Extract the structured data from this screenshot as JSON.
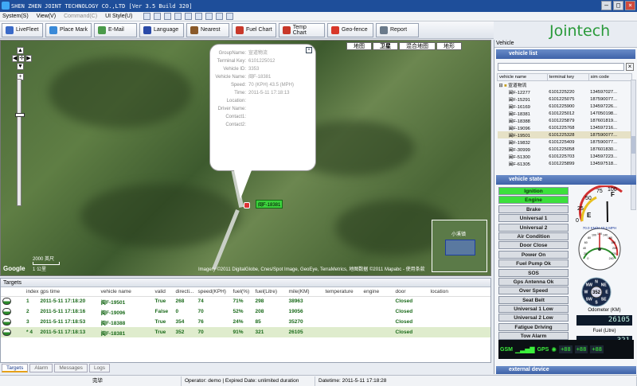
{
  "window": {
    "title": "SHEN ZHEN JOINT TECHNOLOGY CO.,LTD [Ver 3.5  Build 320]"
  },
  "menu": {
    "items": [
      {
        "label": "System(S)",
        "enabled": true
      },
      {
        "label": "View(V)",
        "enabled": true
      },
      {
        "label": "Command(C)",
        "enabled": false
      },
      {
        "label": "UI Style(U)",
        "enabled": true
      }
    ]
  },
  "toolbar": {
    "buttons": [
      {
        "label": "LiveFleet",
        "icon": "fleet-icon",
        "color": "#3a6ac8"
      },
      {
        "label": "Place Mark",
        "icon": "pin-icon",
        "color": "#3a8ad8"
      },
      {
        "label": "E-Mail",
        "icon": "mail-icon",
        "color": "#4a9a4a"
      },
      {
        "label": "Language",
        "icon": "language-icon",
        "color": "#2a4aa8"
      },
      {
        "label": "Nearest",
        "icon": "nearest-icon",
        "color": "#8a5a2a"
      },
      {
        "label": "Fuel Chart",
        "icon": "fuel-icon",
        "color": "#c8382a"
      },
      {
        "label": "Temp Chart",
        "icon": "temp-icon",
        "color": "#c8382a"
      },
      {
        "label": "Geo-fence",
        "icon": "geofence-icon",
        "color": "#d8382a"
      },
      {
        "label": "Report",
        "icon": "report-icon",
        "color": "#6a7a8a"
      }
    ]
  },
  "logo": {
    "text_main": "Jointech",
    "color": "#1a4aa0"
  },
  "map": {
    "tabs": [
      "地图",
      "卫星",
      "混合地图",
      "地形"
    ],
    "active_tab": "卫星",
    "scale_label": "2000 英尺",
    "scale_label_2": "1 公里",
    "copyright": "Imagery ©2011 DigitalGlobe, Cnes/Spot Image, GeoEye, TerraMetrics, 地图数据 ©2011 Mapabc - 使用条款",
    "minimap_label": "小溪镇",
    "vehicle_label": "闽F-18381",
    "google": "Google"
  },
  "popup": {
    "rows": [
      {
        "key": "GroupName:",
        "value": "宣道物流"
      },
      {
        "key": "Terminal Key:",
        "value": "6101225012"
      },
      {
        "key": "Vehicle ID:",
        "value": "3353"
      },
      {
        "key": "Vehicle Name:",
        "value": "闽F-18381"
      },
      {
        "key": "Speed:",
        "value": "70 (KPH) 43.5 (MPH)"
      },
      {
        "key": "Time:",
        "value": "2011-5-11 17:18:13"
      },
      {
        "key": "Location:",
        "value": ""
      },
      {
        "key": "Driver Name:",
        "value": ""
      },
      {
        "key": "Contact1:",
        "value": ""
      },
      {
        "key": "Contact2:",
        "value": ""
      }
    ]
  },
  "targets": {
    "title": "Targets",
    "columns": [
      "index",
      "gps time",
      "vehicle name",
      "valid",
      "directi...",
      "speed(KPH)",
      "fuel(%)",
      "fuel(Litre)",
      "mile(KM)",
      "temperature",
      "engine",
      "door",
      "location"
    ],
    "rows": [
      {
        "index": "1",
        "time": "2011-5-11 17:18:20",
        "name": "闽F-19501",
        "valid": "True",
        "dir": "268",
        "speed": "74",
        "fuelp": "71%",
        "fuell": "298",
        "mile": "38963",
        "temp": "",
        "engine": "",
        "door": "Closed",
        "loc": ""
      },
      {
        "index": "2",
        "time": "2011-5-11 17:18:16",
        "name": "闽F-19096",
        "valid": "False",
        "dir": "0",
        "speed": "70",
        "fuelp": "52%",
        "fuell": "208",
        "mile": "19056",
        "temp": "",
        "engine": "",
        "door": "Closed",
        "loc": ""
      },
      {
        "index": "3",
        "time": "2011-5-11 17:18:53",
        "name": "闽F-18388",
        "valid": "True",
        "dir": "354",
        "speed": "76",
        "fuelp": "24%",
        "fuell": "85",
        "mile": "35270",
        "temp": "",
        "engine": "",
        "door": "Closed",
        "loc": ""
      },
      {
        "index": "* 4",
        "time": "2011-5-11 17:18:13",
        "name": "闽F-18381",
        "valid": "True",
        "dir": "352",
        "speed": "70",
        "fuelp": "91%",
        "fuell": "321",
        "mile": "26105",
        "temp": "",
        "engine": "",
        "door": "Closed",
        "loc": ""
      }
    ]
  },
  "bottom_tabs": [
    "Targets",
    "Alarm",
    "Messages",
    "Logs"
  ],
  "status": {
    "ready": "完毕",
    "operator": "Operator: demo | Expired Date: unlimited duration",
    "datetime": "Datetime: 2011-5-11 17:18:28"
  },
  "vehicle_panel": {
    "title": "Vehicle",
    "list_title": "vehicle list",
    "columns": [
      "vehicle name",
      "terminal key",
      "sim code"
    ],
    "group": "宣道物流",
    "rows": [
      [
        "闽F-12277",
        "6101225220",
        "134597027..."
      ],
      [
        "闽F-15291",
        "6101225075",
        "187590077..."
      ],
      [
        "闽F-16169",
        "6101225900",
        "134597226..."
      ],
      [
        "闽F-18381",
        "6101225012",
        "147050198..."
      ],
      [
        "闽F-18388",
        "6101225879",
        "187601819..."
      ],
      [
        "闽F-19096",
        "6101225768",
        "134597216..."
      ],
      [
        "闽F-19501",
        "6101225328",
        "187590077..."
      ],
      [
        "闽F-19832",
        "6101225409",
        "187590077..."
      ],
      [
        "闽F-30999",
        "6101225058",
        "187601830..."
      ],
      [
        "闽F-51300",
        "6101225703",
        "134597223..."
      ],
      [
        "闽F-61305",
        "6101225899",
        "134597518..."
      ]
    ],
    "selected_index": 6
  },
  "vehicle_state": {
    "title": "vehicle state",
    "items": [
      {
        "label": "Ignition",
        "state": "on"
      },
      {
        "label": "Engine",
        "state": "on"
      },
      {
        "label": "Brake",
        "state": "off"
      },
      {
        "label": "Universal 1",
        "state": "off"
      },
      {
        "label": "Universal 2",
        "state": "off"
      },
      {
        "label": "Air Condition",
        "state": "off"
      },
      {
        "label": "Door Close",
        "state": "off"
      },
      {
        "label": "Power On",
        "state": "off"
      },
      {
        "label": "Fuel Pump Ok",
        "state": "off"
      },
      {
        "label": "SOS",
        "state": "off"
      },
      {
        "label": "Gps Antenna Ok",
        "state": "off"
      },
      {
        "label": "Over Speed",
        "state": "off"
      },
      {
        "label": "Seat Belt",
        "state": "off"
      },
      {
        "label": "Universal 1 Low",
        "state": "off"
      },
      {
        "label": "Universal 2 Low",
        "state": "off"
      },
      {
        "label": "Fatigue Driving",
        "state": "off"
      },
      {
        "label": "Tow Alarm",
        "state": "off"
      }
    ],
    "fuel_gauge": {
      "labels": [
        "0",
        "25",
        "50",
        "75",
        "100"
      ],
      "empty": "E",
      "full": "F",
      "value_percent": 91
    },
    "speed_gauge": {
      "readout": "70.0 KM/H  43.5 MPH",
      "ticks": [
        "0",
        "20",
        "40",
        "60",
        "80",
        "100",
        "120",
        "140",
        "160",
        "180",
        "200",
        "220",
        "240"
      ]
    },
    "compass": {
      "heading": "352",
      "labels": [
        "N",
        "NE",
        "E",
        "SE",
        "S",
        "SW",
        "W",
        "NW"
      ]
    },
    "odometer_label": "Odometer (KM)",
    "odometer_value": "26105",
    "fuel_label": "Fuel (Litre)",
    "fuel_value": "321",
    "gsm": "GSM",
    "gps": "GPS",
    "segments": [
      "+88",
      "+88",
      "+88"
    ],
    "colors": {
      "on": "#3ce03c",
      "off": "#d9dde3",
      "blue": "#1a46b8"
    }
  },
  "external_device": {
    "title": "external device"
  }
}
